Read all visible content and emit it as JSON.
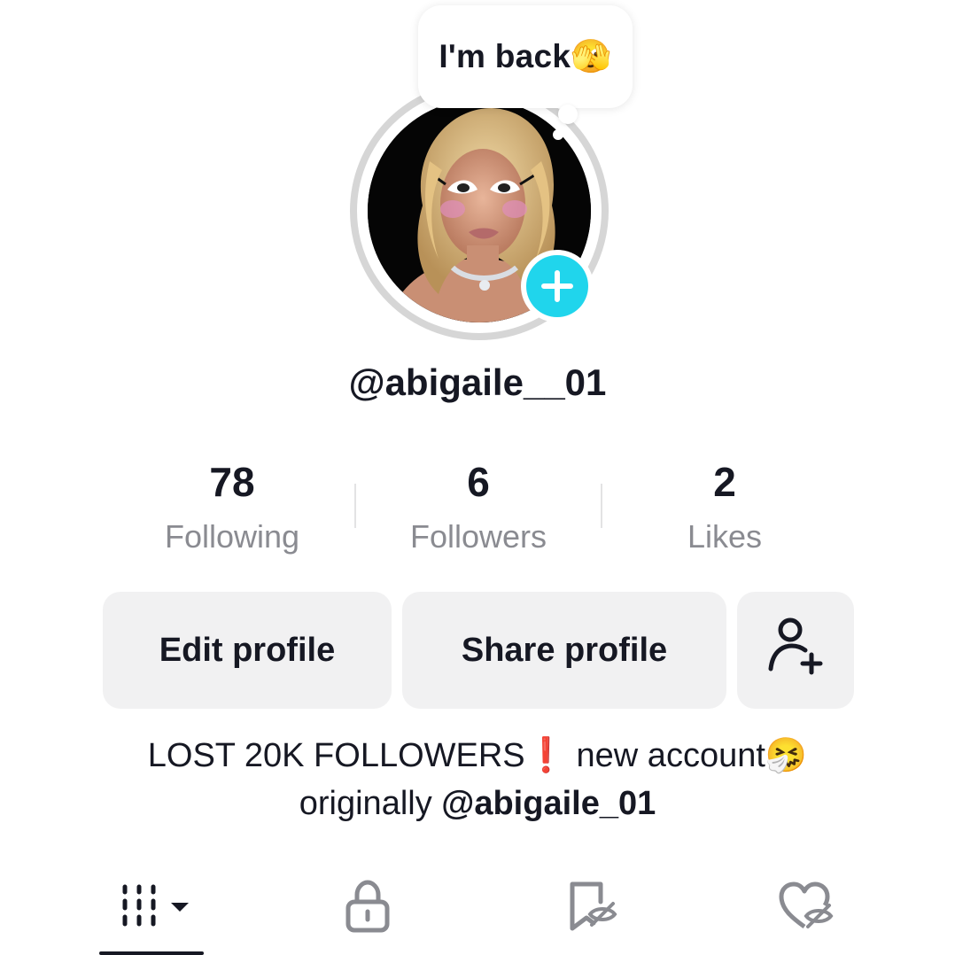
{
  "note": {
    "text": "I'm back🫣"
  },
  "profile": {
    "username": "@abigaile__01"
  },
  "stats": {
    "following": {
      "value": "78",
      "label": "Following"
    },
    "followers": {
      "value": "6",
      "label": "Followers"
    },
    "likes": {
      "value": "2",
      "label": "Likes"
    }
  },
  "buttons": {
    "edit_label": "Edit profile",
    "share_label": "Share profile",
    "add_friend_icon": "person-add-icon"
  },
  "bio": {
    "line1_prefix": "LOST 20K FOLLOWERS",
    "line1_exclamation": "❗",
    "line1_suffix": " new account🤧",
    "line2_prefix": "originally ",
    "line2_mention": "@abigaile_01"
  },
  "tabs": [
    {
      "name": "videos",
      "icon": "grid-icon",
      "active": true
    },
    {
      "name": "private",
      "icon": "lock-icon",
      "active": false
    },
    {
      "name": "saved",
      "icon": "saved-hidden-icon",
      "active": false
    },
    {
      "name": "liked",
      "icon": "liked-hidden-icon",
      "active": false
    }
  ],
  "colors": {
    "accent": "#20d5ec",
    "text": "#161823",
    "muted": "#8a8b91",
    "button_bg": "#f1f1f2",
    "exclamation": "#e5322d"
  }
}
